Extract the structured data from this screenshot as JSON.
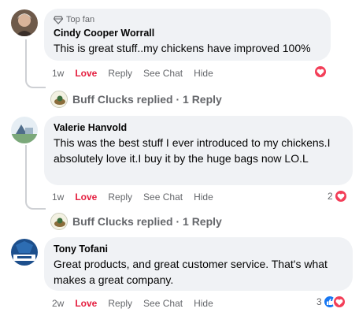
{
  "comments": [
    {
      "badge": "Top fan",
      "author": "Cindy Cooper Worrall",
      "text": "This is great stuff..my chickens have improved 100%",
      "time": "1w",
      "love_label": "Love",
      "reply_label": "Reply",
      "see_chat_label": "See Chat",
      "hide_label": "Hide",
      "reaction_count": ""
    },
    {
      "author": "Valerie Hanvold",
      "text": "This was the best stuff I ever introduced to my chickens.I absolutely love it.I buy it by the huge bags now LO.L",
      "time": "1w",
      "love_label": "Love",
      "reply_label": "Reply",
      "see_chat_label": "See Chat",
      "hide_label": "Hide",
      "reaction_count": "2"
    },
    {
      "author": "Tony Tofani",
      "text": "Great products, and great customer service. That's what makes a great company.",
      "time": "2w",
      "love_label": "Love",
      "reply_label": "Reply",
      "see_chat_label": "See Chat",
      "hide_label": "Hide",
      "reaction_count": "3"
    }
  ],
  "reply_summaries": [
    {
      "text": "Buff Clucks replied · 1 Reply"
    },
    {
      "text": "Buff Clucks replied · 1 Reply"
    }
  ],
  "colors": {
    "love": "#e41e3f",
    "bubble": "#f0f2f5",
    "muted": "#65676b",
    "like": "#1877f2"
  }
}
